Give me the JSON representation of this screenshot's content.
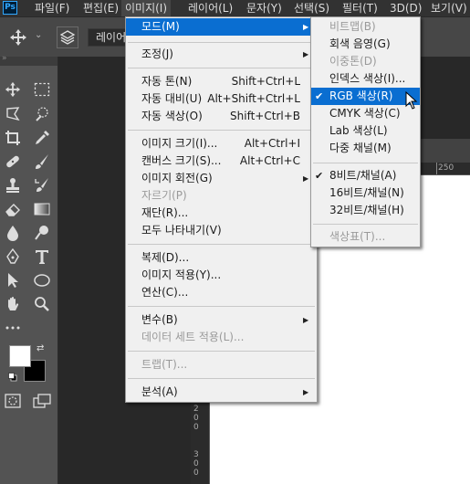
{
  "menubar": {
    "logo": "Ps",
    "items": [
      "파일(F)",
      "편집(E)",
      "이미지(I)",
      "레이어(L)",
      "문자(Y)",
      "선택(S)",
      "필터(T)",
      "3D(D)",
      "보기(V)"
    ]
  },
  "options": {
    "layer_field": "레이어"
  },
  "image_menu": {
    "items": [
      {
        "label": "모드(M)"
      },
      {
        "label": "조정(J)"
      },
      {
        "label": "자동 톤(N)",
        "shortcut": "Shift+Ctrl+L"
      },
      {
        "label": "자동 대비(U)",
        "shortcut": "Alt+Shift+Ctrl+L"
      },
      {
        "label": "자동 색상(O)",
        "shortcut": "Shift+Ctrl+B"
      },
      {
        "label": "이미지 크기(I)...",
        "shortcut": "Alt+Ctrl+I"
      },
      {
        "label": "캔버스 크기(S)...",
        "shortcut": "Alt+Ctrl+C"
      },
      {
        "label": "이미지 회전(G)"
      },
      {
        "label": "자르기(P)"
      },
      {
        "label": "재단(R)..."
      },
      {
        "label": "모두 나타내기(V)"
      },
      {
        "label": "복제(D)..."
      },
      {
        "label": "이미지 적용(Y)..."
      },
      {
        "label": "연산(C)..."
      },
      {
        "label": "변수(B)"
      },
      {
        "label": "데이터 세트 적용(L)..."
      },
      {
        "label": "트랩(T)..."
      },
      {
        "label": "분석(A)"
      }
    ]
  },
  "mode_menu": {
    "items": [
      {
        "label": "비트맵(B)"
      },
      {
        "label": "회색 음영(G)"
      },
      {
        "label": "이중톤(D)"
      },
      {
        "label": "인덱스 색상(I)..."
      },
      {
        "label": "RGB 색상(R)"
      },
      {
        "label": "CMYK 색상(C)"
      },
      {
        "label": "Lab 색상(L)"
      },
      {
        "label": "다중 채널(M)"
      },
      {
        "label": "8비트/채널(A)"
      },
      {
        "label": "16비트/채널(N)"
      },
      {
        "label": "32비트/채널(H)"
      },
      {
        "label": "색상표(T)..."
      }
    ]
  },
  "ruler": {
    "h_label": "250",
    "v_labels": [
      "2",
      "0",
      "0",
      "3",
      "0",
      "0"
    ]
  },
  "colors": {
    "highlight": "#0a6ed1",
    "menu_bg": "#f0f0f0",
    "menubar_bg": "#323232",
    "canvas": "#ffffff"
  }
}
